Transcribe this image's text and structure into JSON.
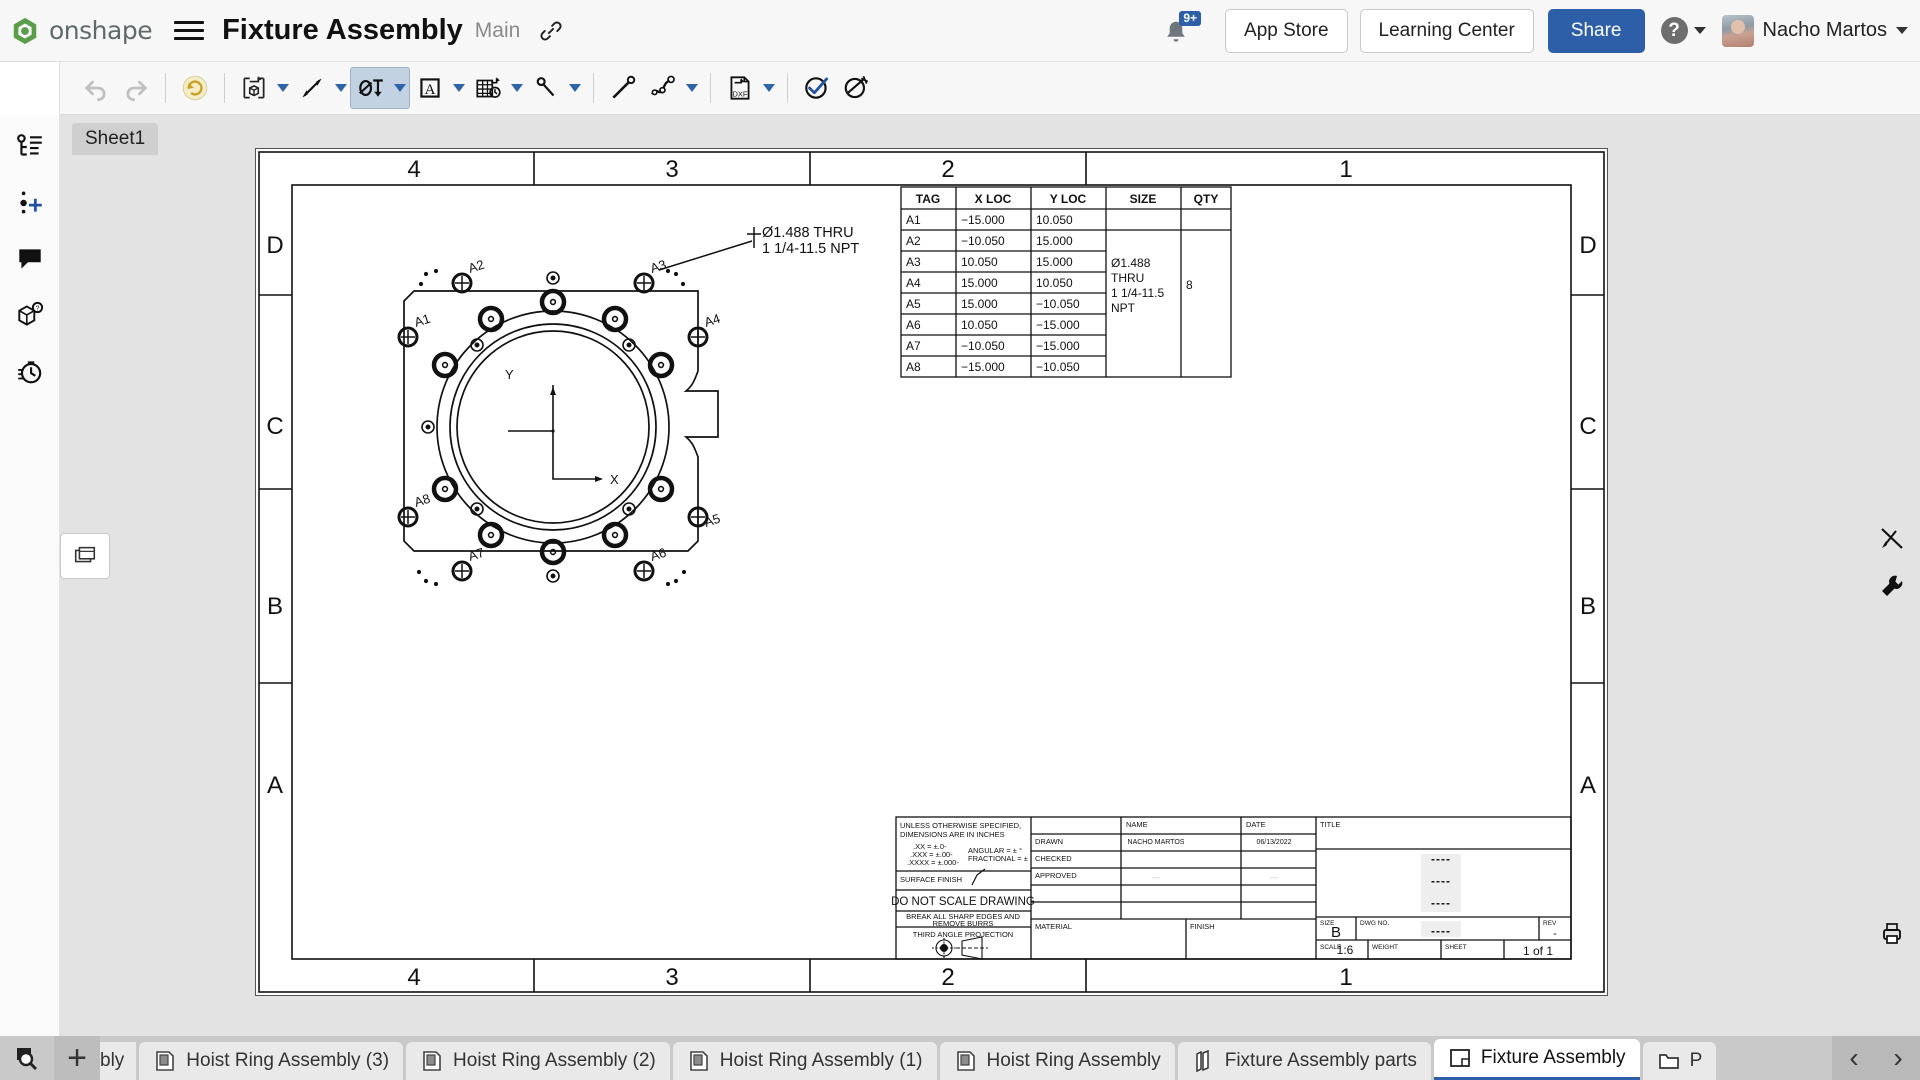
{
  "app": {
    "brand": "onshape",
    "document_title": "Fixture Assembly",
    "workspace": "Main",
    "notification_badge": "9+",
    "app_store_label": "App Store",
    "learning_center_label": "Learning Center",
    "share_label": "Share",
    "help_label": "?",
    "user_name": "Nacho Martos"
  },
  "toolbar": {
    "items": [
      {
        "name": "drawing-tree-icon",
        "glyph": "tree"
      },
      {
        "name": "undo-icon",
        "glyph": "undo"
      },
      {
        "name": "redo-icon",
        "glyph": "redo"
      },
      {
        "name": "rotate-view-icon",
        "glyph": "rotate"
      },
      {
        "name": "insert-view-icon",
        "glyph": "insertview"
      },
      {
        "name": "dimension-icon",
        "glyph": "dimension"
      },
      {
        "name": "hole-callout-icon",
        "glyph": "holecallout"
      },
      {
        "name": "note-icon",
        "glyph": "note"
      },
      {
        "name": "table-icon",
        "glyph": "table"
      },
      {
        "name": "balloon-icon",
        "glyph": "balloon"
      },
      {
        "name": "line-icon",
        "glyph": "line"
      },
      {
        "name": "spline-icon",
        "glyph": "spline"
      },
      {
        "name": "dxf-export-icon",
        "glyph": "dxf"
      },
      {
        "name": "check-drawing-icon",
        "glyph": "checkdraw"
      },
      {
        "name": "measure-icon",
        "glyph": "measure"
      }
    ]
  },
  "left_rail": {
    "items": [
      {
        "name": "sidebar-item-drawing-tree",
        "label": "Drawing tree"
      },
      {
        "name": "sidebar-item-insert",
        "label": "Insert"
      },
      {
        "name": "sidebar-item-comments",
        "label": "Comments"
      },
      {
        "name": "sidebar-item-views",
        "label": "Views"
      },
      {
        "name": "sidebar-item-history",
        "label": "History"
      }
    ]
  },
  "canvas": {
    "sheet_tab_label": "Sheet1",
    "stack_button_name": "view-stack-button",
    "right_tools": [
      {
        "name": "hide-annotations-button",
        "label": "Hide annotations"
      },
      {
        "name": "drawing-properties-button",
        "label": "Drawing properties"
      },
      {
        "name": "print-button",
        "label": "Print"
      }
    ]
  },
  "drawing": {
    "zone_columns_top": [
      "4",
      "3",
      "2",
      "1"
    ],
    "zone_columns_bottom": [
      "4",
      "3",
      "2",
      "1"
    ],
    "zone_rows_left": [
      "D",
      "C",
      "B",
      "A"
    ],
    "zone_rows_right": [
      "D",
      "C",
      "B",
      "A"
    ],
    "callout": {
      "line1": "Ø1.488 THRU",
      "line2": "1 1/4-11.5 NPT"
    },
    "axis_labels": {
      "x": "X",
      "y": "Y"
    },
    "hole_tags": [
      "A1",
      "A2",
      "A3",
      "A4",
      "A5",
      "A6",
      "A7",
      "A8"
    ]
  },
  "hole_table": {
    "headers": [
      "TAG",
      "X LOC",
      "Y LOC",
      "SIZE",
      "QTY"
    ],
    "rows": [
      {
        "tag": "A1",
        "x": "−15.000",
        "y": "10.050"
      },
      {
        "tag": "A2",
        "x": "−10.050",
        "y": "15.000"
      },
      {
        "tag": "A3",
        "x": "10.050",
        "y": "15.000"
      },
      {
        "tag": "A4",
        "x": "15.000",
        "y": "10.050"
      },
      {
        "tag": "A5",
        "x": "15.000",
        "y": "−10.050"
      },
      {
        "tag": "A6",
        "x": "10.050",
        "y": "−15.000"
      },
      {
        "tag": "A7",
        "x": "−10.050",
        "y": "−15.000"
      },
      {
        "tag": "A8",
        "x": "−15.000",
        "y": "−10.050"
      }
    ],
    "size": [
      "Ø1.488",
      "THRU",
      "1 1/4-11.5",
      "NPT"
    ],
    "qty": "8"
  },
  "title_block": {
    "note_line1": "UNLESS OTHERWISE SPECIFIED,",
    "note_line2": "DIMENSIONS ARE IN INCHES",
    "tol_xx": ".XX = ±.0-",
    "tol_xxx": ".XXX = ±.00-",
    "tol_xxxx": ".XXXX = ±.000-",
    "tol_angular": "ANGULAR = ± °",
    "tol_fractional": "FRACTIONAL = ±",
    "surface_finish": "SURFACE FINISH",
    "do_not_scale": "DO NOT SCALE DRAWING",
    "break_edges_line1": "BREAK ALL SHARP EDGES AND",
    "break_edges_line2": "REMOVE BURRS",
    "third_angle": "THIRD ANGLE PROJECTION",
    "col_name": "NAME",
    "col_date": "DATE",
    "row_drawn": "DRAWN",
    "row_checked": "CHECKED",
    "row_approved": "APPROVED",
    "drawn_name": "NACHO MARTOS",
    "drawn_date": "06/13/2022",
    "material_label": "MATERIAL",
    "finish_label": "FINISH",
    "title_label": "TITLE",
    "title_value_1": "----",
    "title_value_2": "----",
    "title_value_3": "----",
    "size_label": "SIZE",
    "size_value": "B",
    "dwg_no_label": "DWG NO.",
    "dwg_no_value": "----",
    "rev_label": "REV",
    "rev_value": "-",
    "scale_label": "SCALE",
    "scale_value": "1:6",
    "weight_label": "WEIGHT",
    "sheet_label": "SHEET",
    "sheet_value": "1 of 1"
  },
  "tabbar": {
    "search_name": "tab-search-button",
    "plus_label": "+",
    "tabs": [
      {
        "label": "bly",
        "icon": "part-studio-icon",
        "active": false,
        "clipped": true
      },
      {
        "label": "Hoist Ring Assembly (3)",
        "icon": "assembly-icon",
        "active": false
      },
      {
        "label": "Hoist Ring Assembly (2)",
        "icon": "assembly-icon",
        "active": false
      },
      {
        "label": "Hoist Ring Assembly (1)",
        "icon": "assembly-icon",
        "active": false
      },
      {
        "label": "Hoist Ring Assembly",
        "icon": "assembly-icon",
        "active": false
      },
      {
        "label": "Fixture Assembly parts",
        "icon": "part-studio-icon",
        "active": false
      },
      {
        "label": "Fixture Assembly",
        "icon": "drawing-icon",
        "active": true
      },
      {
        "label": "P",
        "icon": "folder-icon",
        "active": false
      }
    ],
    "nav_prev": "‹",
    "nav_next": "›"
  },
  "colors": {
    "accent": "#2d5fa8",
    "toolbar_bg": "#f7f7f7",
    "canvas_bg": "#e3e3e3",
    "tabbar_bg": "#c9c9c9"
  }
}
